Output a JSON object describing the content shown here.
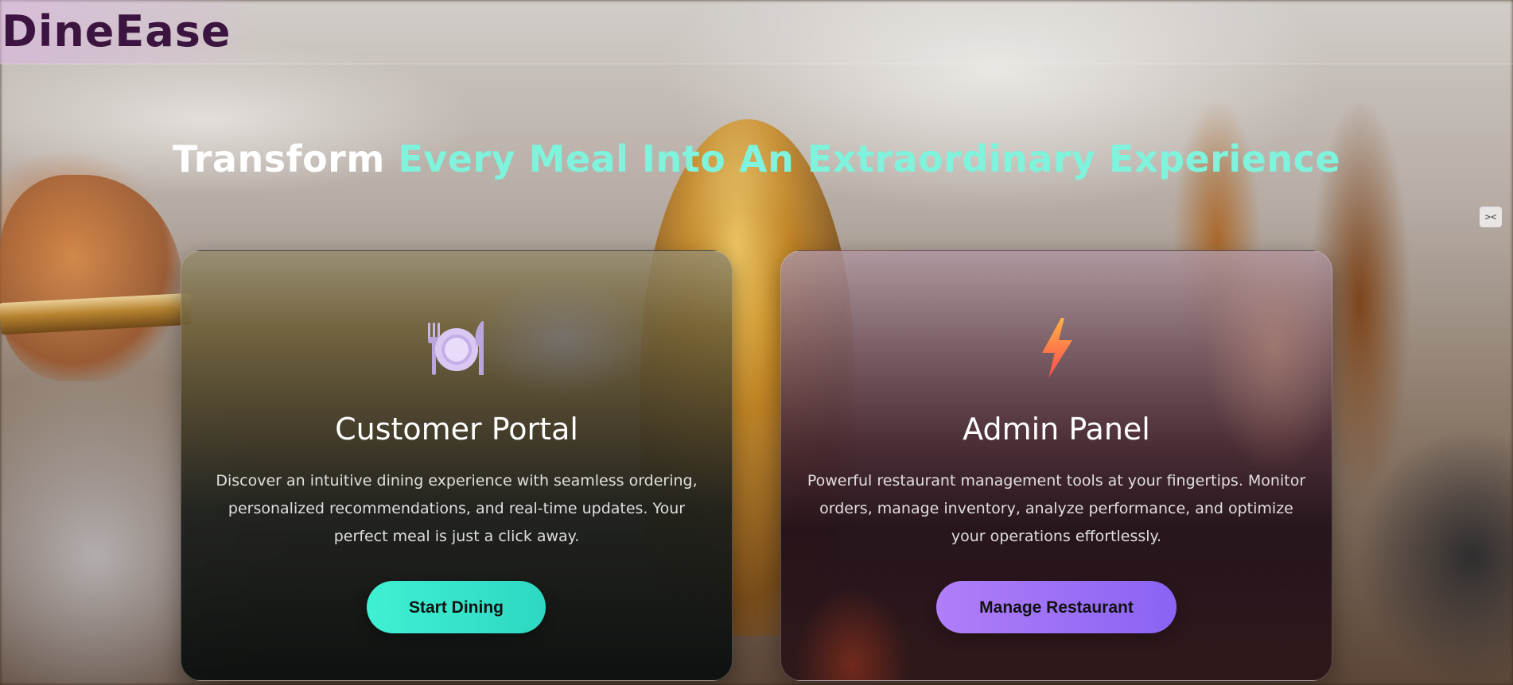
{
  "app": {
    "brand": "DineEase"
  },
  "hero": {
    "title_part1": "Transform",
    "title_part2": "Every Meal Into An Extraordinary Experience"
  },
  "side_toggle": {
    "label": "><"
  },
  "cards": [
    {
      "icon": "fork-knife-plate-icon",
      "title": "Customer Portal",
      "description": "Discover an intuitive dining experience with seamless ordering, personalized recommendations, and real-time updates. Your perfect meal is just a click away.",
      "button_label": "Start Dining",
      "accent": "#3ff0d2"
    },
    {
      "icon": "lightning-bolt-icon",
      "title": "Admin Panel",
      "description": "Powerful restaurant management tools at your fingertips. Monitor orders, manage inventory, analyze performance, and optimize your operations effortlessly.",
      "button_label": "Manage Restaurant",
      "accent": "#9b6ff6"
    }
  ],
  "colors": {
    "logo": "#3c1440",
    "hero_white": "#ffffff",
    "hero_accent": "#7ff3dc"
  }
}
